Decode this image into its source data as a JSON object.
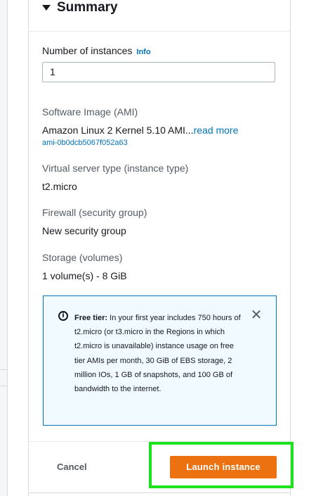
{
  "summary": {
    "title": "Summary",
    "instances": {
      "label": "Number of instances",
      "info": "Info",
      "value": "1"
    },
    "ami": {
      "label": "Software Image (AMI)",
      "value": "Amazon Linux 2 Kernel 5.10 AMI...",
      "read_more": "read more",
      "id": "ami-0b0dcb5067f052a63"
    },
    "instance_type": {
      "label": "Virtual server type (instance type)",
      "value": "t2.micro"
    },
    "firewall": {
      "label": "Firewall (security group)",
      "value": "New security group"
    },
    "storage": {
      "label": "Storage (volumes)",
      "value": "1 volume(s) - 8 GiB"
    },
    "free_tier": {
      "title": "Free tier:",
      "body": "In your first year includes 750 hours of t2.micro (or t3.micro in the Regions in which t2.micro is unavailable) instance usage on free tier AMIs per month, 30 GiB of EBS storage, 2 million IOs, 1 GB of snapshots, and 100 GB of bandwidth to the internet.",
      "icon": "info-circle-icon",
      "close_icon": "close-icon"
    }
  },
  "footer": {
    "cancel_label": "Cancel",
    "launch_label": "Launch instance"
  },
  "colors": {
    "link": "#0073bb",
    "primary_button": "#ec7211",
    "highlight": "#1ee21e",
    "alert_bg": "#f1faff"
  }
}
